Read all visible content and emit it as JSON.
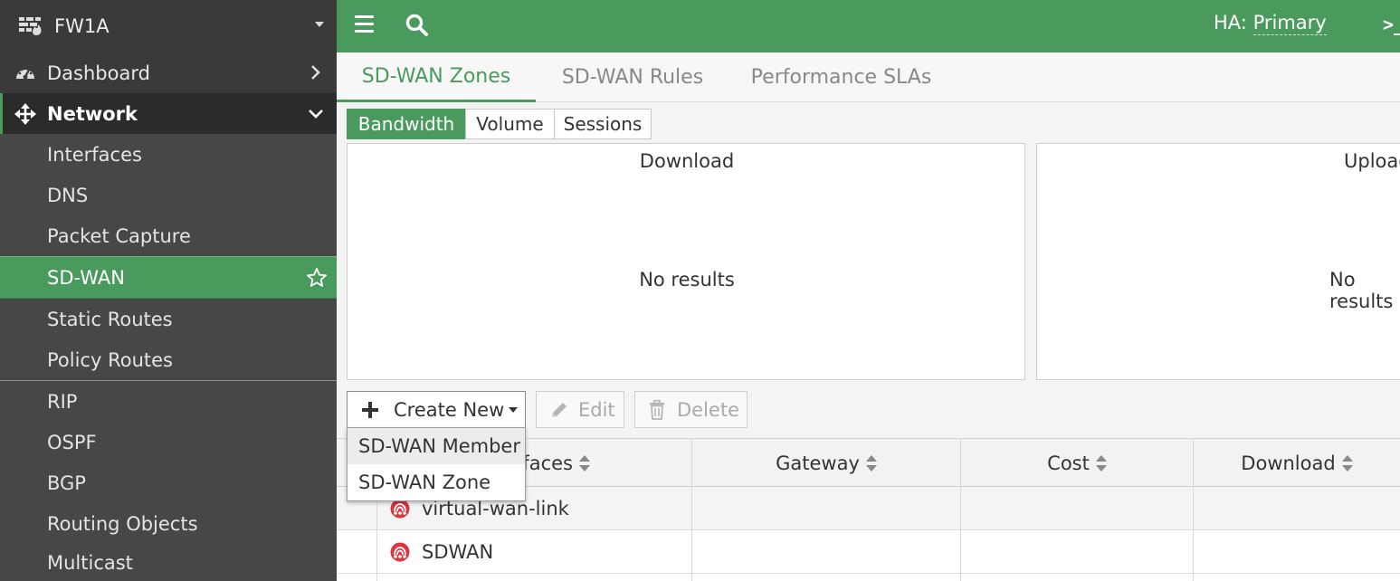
{
  "sidebar": {
    "device_name": "FW1A",
    "items": [
      {
        "label": "Dashboard"
      },
      {
        "label": "Network"
      },
      {
        "label": "Interfaces"
      },
      {
        "label": "DNS"
      },
      {
        "label": "Packet Capture"
      },
      {
        "label": "SD-WAN"
      },
      {
        "label": "Static Routes"
      },
      {
        "label": "Policy Routes"
      },
      {
        "label": "RIP"
      },
      {
        "label": "OSPF"
      },
      {
        "label": "BGP"
      },
      {
        "label": "Routing Objects"
      },
      {
        "label": "Multicast"
      }
    ]
  },
  "topbar": {
    "ha_label": "HA:",
    "ha_value": "Primary",
    "cli_glyph": ">_"
  },
  "tabs": [
    "SD-WAN Zones",
    "SD-WAN Rules",
    "Performance SLAs"
  ],
  "segments": [
    "Bandwidth",
    "Volume",
    "Sessions"
  ],
  "panels": {
    "download": {
      "title": "Download",
      "empty": "No results"
    },
    "upload": {
      "title": "Upload",
      "empty": "No results"
    }
  },
  "toolbar": {
    "create_label": "Create New",
    "edit_label": "Edit",
    "delete_label": "Delete"
  },
  "dropdown": [
    "SD-WAN Member",
    "SD-WAN Zone"
  ],
  "table": {
    "headers": [
      "Interfaces",
      "Gateway",
      "Cost",
      "Download"
    ],
    "rows": [
      {
        "name": "virtual-wan-link"
      },
      {
        "name": "SDWAN"
      }
    ]
  },
  "colors": {
    "brand_green": "#4a9a5e",
    "sidebar_bg": "#3a3a3a",
    "zone_icon_red": "#d9363e"
  }
}
